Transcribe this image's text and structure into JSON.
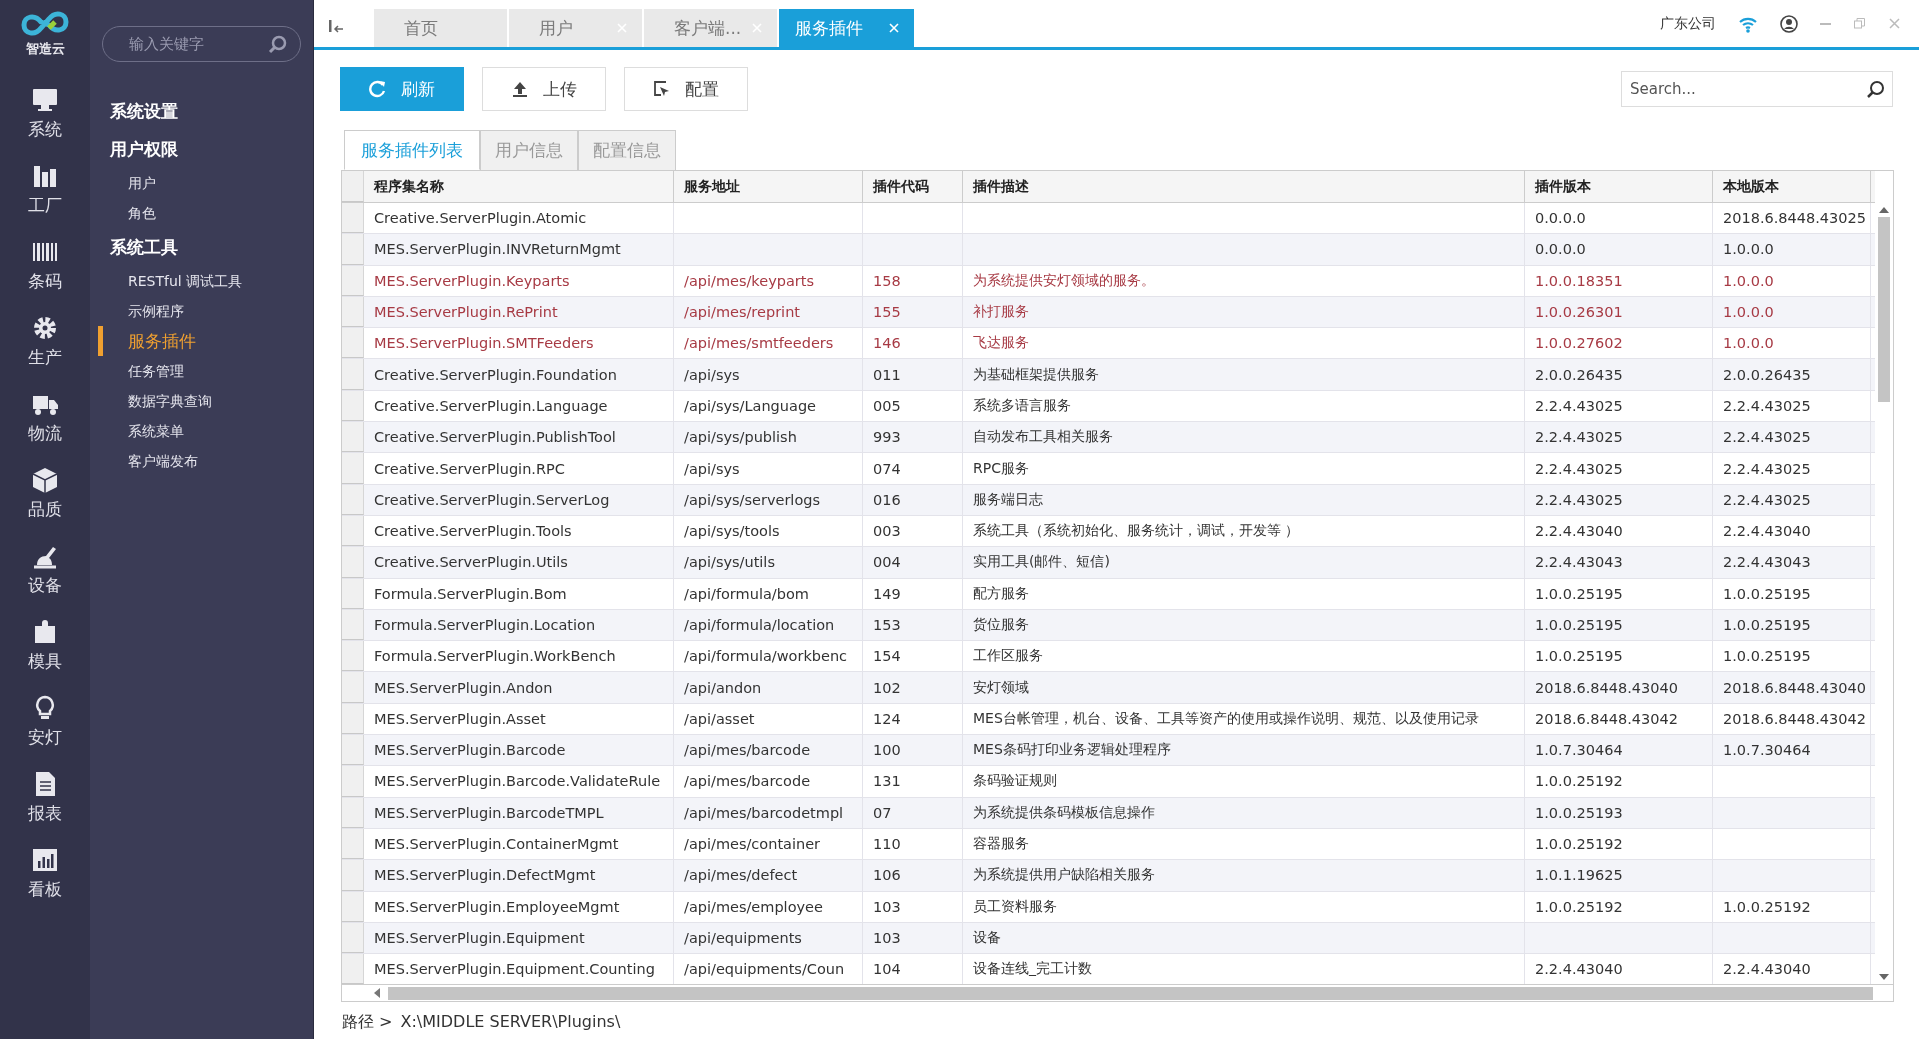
{
  "logo": {
    "text": "智造云"
  },
  "rail": [
    {
      "label": "系统"
    },
    {
      "label": "工厂"
    },
    {
      "label": "条码"
    },
    {
      "label": "生产"
    },
    {
      "label": "物流"
    },
    {
      "label": "品质"
    },
    {
      "label": "设备"
    },
    {
      "label": "模具"
    },
    {
      "label": "安灯"
    },
    {
      "label": "报表"
    },
    {
      "label": "看板"
    }
  ],
  "menu_search": {
    "placeholder": "输入关键字"
  },
  "menu": [
    {
      "label": "系统设置"
    },
    {
      "label": "用户权限",
      "children": [
        {
          "label": "用户",
          "selected": false
        },
        {
          "label": "角色",
          "selected": false
        }
      ]
    },
    {
      "label": "系统工具",
      "children": [
        {
          "label": "RESTful 调试工具",
          "selected": false
        },
        {
          "label": "示例程序",
          "selected": false
        },
        {
          "label": "服务插件",
          "selected": true
        },
        {
          "label": "任务管理",
          "selected": false
        },
        {
          "label": "数据字典查询",
          "selected": false
        },
        {
          "label": "系统菜单",
          "selected": false
        },
        {
          "label": "客户端发布",
          "selected": false
        }
      ]
    }
  ],
  "tabs": [
    {
      "label": "首页",
      "closable": false,
      "selected": false
    },
    {
      "label": "用户",
      "closable": true,
      "selected": false
    },
    {
      "label": "客户端...",
      "closable": true,
      "selected": false
    },
    {
      "label": "服务插件",
      "closable": true,
      "selected": true
    }
  ],
  "company": "广东公司",
  "toolbar": [
    {
      "label": "刷新",
      "kind": "refresh",
      "primary": true
    },
    {
      "label": "上传",
      "kind": "upload",
      "primary": false
    },
    {
      "label": "配置",
      "kind": "config",
      "primary": false
    }
  ],
  "search": {
    "placeholder": "Search..."
  },
  "subtabs": [
    {
      "label": "服务插件列表",
      "selected": true
    },
    {
      "label": "用户信息",
      "selected": false
    },
    {
      "label": "配置信息",
      "selected": false
    }
  ],
  "table": {
    "columns": [
      "程序集名称",
      "服务地址",
      "插件代码",
      "插件描述",
      "插件版本",
      "本地版本"
    ],
    "rows": [
      {
        "flagged": false,
        "cells": [
          "Creative.ServerPlugin.Atomic",
          "",
          "",
          "",
          "0.0.0.0",
          "2018.6.8448.43025"
        ]
      },
      {
        "flagged": false,
        "cells": [
          "MES.ServerPlugin.INVReturnMgmt",
          "",
          "",
          "",
          "0.0.0.0",
          "1.0.0.0"
        ]
      },
      {
        "flagged": true,
        "cells": [
          "MES.ServerPlugin.Keyparts",
          "/api/mes/keyparts",
          "158",
          "为系统提供安灯领域的服务。",
          "1.0.0.18351",
          "1.0.0.0"
        ]
      },
      {
        "flagged": true,
        "cells": [
          "MES.ServerPlugin.RePrint",
          "/api/mes/reprint",
          "155",
          "补打服务",
          "1.0.0.26301",
          "1.0.0.0"
        ]
      },
      {
        "flagged": true,
        "cells": [
          "MES.ServerPlugin.SMTFeeders",
          "/api/mes/smtfeeders",
          "146",
          "飞达服务",
          "1.0.0.27602",
          "1.0.0.0"
        ]
      },
      {
        "flagged": false,
        "cells": [
          "Creative.ServerPlugin.Foundation",
          "/api/sys",
          "011",
          "为基础框架提供服务",
          "2.0.0.26435",
          "2.0.0.26435"
        ]
      },
      {
        "flagged": false,
        "cells": [
          "Creative.ServerPlugin.Language",
          "/api/sys/Language",
          "005",
          "系统多语言服务",
          "2.2.4.43025",
          "2.2.4.43025"
        ]
      },
      {
        "flagged": false,
        "cells": [
          "Creative.ServerPlugin.PublishTool",
          "/api/sys/publish",
          "993",
          "自动发布工具相关服务",
          "2.2.4.43025",
          "2.2.4.43025"
        ]
      },
      {
        "flagged": false,
        "cells": [
          "Creative.ServerPlugin.RPC",
          "/api/sys",
          "074",
          "RPC服务",
          "2.2.4.43025",
          "2.2.4.43025"
        ]
      },
      {
        "flagged": false,
        "cells": [
          "Creative.ServerPlugin.ServerLog",
          "/api/sys/serverlogs",
          "016",
          "服务端日志",
          "2.2.4.43025",
          "2.2.4.43025"
        ]
      },
      {
        "flagged": false,
        "cells": [
          "Creative.ServerPlugin.Tools",
          "/api/sys/tools",
          "003",
          "系统工具（系统初始化、服务统计，调试，开发等 ）",
          "2.2.4.43040",
          "2.2.4.43040"
        ]
      },
      {
        "flagged": false,
        "cells": [
          "Creative.ServerPlugin.Utils",
          "/api/sys/utils",
          "004",
          "实用工具(邮件、短信)",
          "2.2.4.43043",
          "2.2.4.43043"
        ]
      },
      {
        "flagged": false,
        "cells": [
          "Formula.ServerPlugin.Bom",
          "/api/formula/bom",
          "149",
          "配方服务",
          "1.0.0.25195",
          "1.0.0.25195"
        ]
      },
      {
        "flagged": false,
        "cells": [
          "Formula.ServerPlugin.Location",
          "/api/formula/location",
          "153",
          "货位服务",
          "1.0.0.25195",
          "1.0.0.25195"
        ]
      },
      {
        "flagged": false,
        "cells": [
          "Formula.ServerPlugin.WorkBench",
          "/api/formula/workbenc",
          "154",
          "工作区服务",
          "1.0.0.25195",
          "1.0.0.25195"
        ]
      },
      {
        "flagged": false,
        "cells": [
          "MES.ServerPlugin.Andon",
          "/api/andon",
          "102",
          "安灯领域",
          "2018.6.8448.43040",
          "2018.6.8448.43040"
        ]
      },
      {
        "flagged": false,
        "cells": [
          "MES.ServerPlugin.Asset",
          "/api/asset",
          "124",
          "MES台帐管理，机台、设备、工具等资产的使用或操作说明、规范、以及使用记录",
          "2018.6.8448.43042",
          "2018.6.8448.43042"
        ]
      },
      {
        "flagged": false,
        "cells": [
          "MES.ServerPlugin.Barcode",
          "/api/mes/barcode",
          "100",
          "MES条码打印业务逻辑处理程序",
          "1.0.7.30464",
          "1.0.7.30464"
        ]
      },
      {
        "flagged": false,
        "cells": [
          "MES.ServerPlugin.Barcode.ValidateRule",
          "/api/mes/barcode",
          "131",
          "条码验证规则",
          "1.0.0.25192",
          ""
        ]
      },
      {
        "flagged": false,
        "cells": [
          "MES.ServerPlugin.BarcodeTMPL",
          "/api/mes/barcodetmpl",
          "07",
          "为系统提供条码模板信息操作",
          "1.0.0.25193",
          ""
        ]
      },
      {
        "flagged": false,
        "cells": [
          "MES.ServerPlugin.ContainerMgmt",
          "/api/mes/container",
          "110",
          "容器服务",
          "1.0.0.25192",
          ""
        ]
      },
      {
        "flagged": false,
        "cells": [
          "MES.ServerPlugin.DefectMgmt",
          "/api/mes/defect",
          "106",
          "为系统提供用户缺陷相关服务",
          "1.0.1.19625",
          ""
        ]
      },
      {
        "flagged": false,
        "cells": [
          "MES.ServerPlugin.EmployeeMgmt",
          "/api/mes/employee",
          "103",
          "员工资料服务",
          "1.0.0.25192",
          "1.0.0.25192"
        ]
      },
      {
        "flagged": false,
        "cells": [
          "MES.ServerPlugin.Equipment",
          "/api/equipments",
          "103",
          "设备",
          "",
          ""
        ]
      },
      {
        "flagged": false,
        "cells": [
          "MES.ServerPlugin.Equipment.Counting",
          "/api/equipments/Coun",
          "104",
          "设备连线_完工计数",
          "2.2.4.43040",
          "2.2.4.43040"
        ]
      }
    ]
  },
  "path": {
    "label": "路径 >",
    "value": "X:\\MIDDLE SERVER\\Plugins\\"
  }
}
